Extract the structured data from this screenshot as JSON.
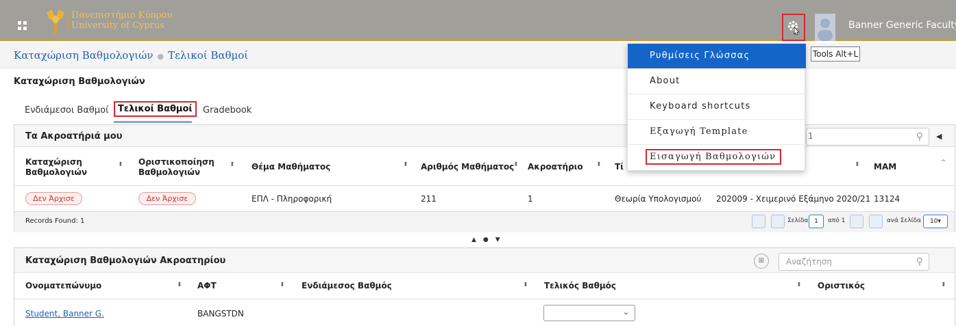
{
  "header": {
    "logo_text_line1": "Πανεπιστήμιο Κύπρου",
    "logo_text_line2": "University of Cyprus",
    "user_name": "Banner Generic Faculty",
    "tools_icon": "gear-icon",
    "brand_color": "#d29a3a"
  },
  "breadcrumb": {
    "item1": "Καταχώριση Βαθμολογιών",
    "item2": "Τελικοί Βαθμοί"
  },
  "page_title": "Καταχώριση Βαθμολογιών",
  "tabs": [
    {
      "label": "Ενδιάμεσοι Βαθμοί"
    },
    {
      "label": "Τελικοί Βαθμοί"
    },
    {
      "label": "Gradebook"
    }
  ],
  "courses": {
    "title": "Τα Ακροατήριά μου",
    "search_value": "1",
    "columns": {
      "entry": "Καταχώριση Βαθμολογιών",
      "finalize": "Οριστικοποίηση Βαθμολογιών",
      "subject": "Θέμα Μαθήματος",
      "course_number": "Αριθμός Μαθήματος",
      "section": "Ακροατήριο",
      "title_partial": "Τί",
      "mam": "MAM"
    },
    "rows": [
      {
        "entry_status": "Δεν Άρχισε",
        "finalize_status": "Δεν Άρχισε",
        "subject": "ΕΠΛ - Πληροφορική",
        "course_number": "211",
        "section": "1",
        "title": "Θεωρία Υπολογισμού",
        "term": "202009 - Χειμερινό Εξάμηνο 2020/21",
        "mam": "13124"
      }
    ],
    "records_found": "Records Found: 1",
    "pager": {
      "page_label": "Σελίδα",
      "page_value": "1",
      "of_label": "από 1",
      "per_page_label": "ανά Σελίδα",
      "per_page_value": "10"
    }
  },
  "roster": {
    "title": "Καταχώριση Βαθμολογιών Ακροατηρίου",
    "search_placeholder": "Αναζήτηση",
    "columns": {
      "name": "Ονοματεπώνυμο",
      "id": "ΑΦΤ",
      "midterm": "Ενδιάμεσος Βαθμός",
      "final": "Τελικός Βαθμός",
      "rolled": "Οριστικός"
    },
    "rows": [
      {
        "name": "Student, Banner G.",
        "id": "BANGSTDN",
        "final_value": ""
      }
    ]
  },
  "tools_menu": {
    "items": [
      {
        "label": "Ρυθμίσεις Γλώσσας"
      },
      {
        "label": "About"
      },
      {
        "label": "Keyboard shortcuts"
      },
      {
        "label": "Εξαγωγή Template"
      },
      {
        "label": "Εισαγωγή Βαθμολογιών"
      }
    ],
    "tooltip": "Tools Alt+L",
    "selected_color": "#1565c8"
  }
}
